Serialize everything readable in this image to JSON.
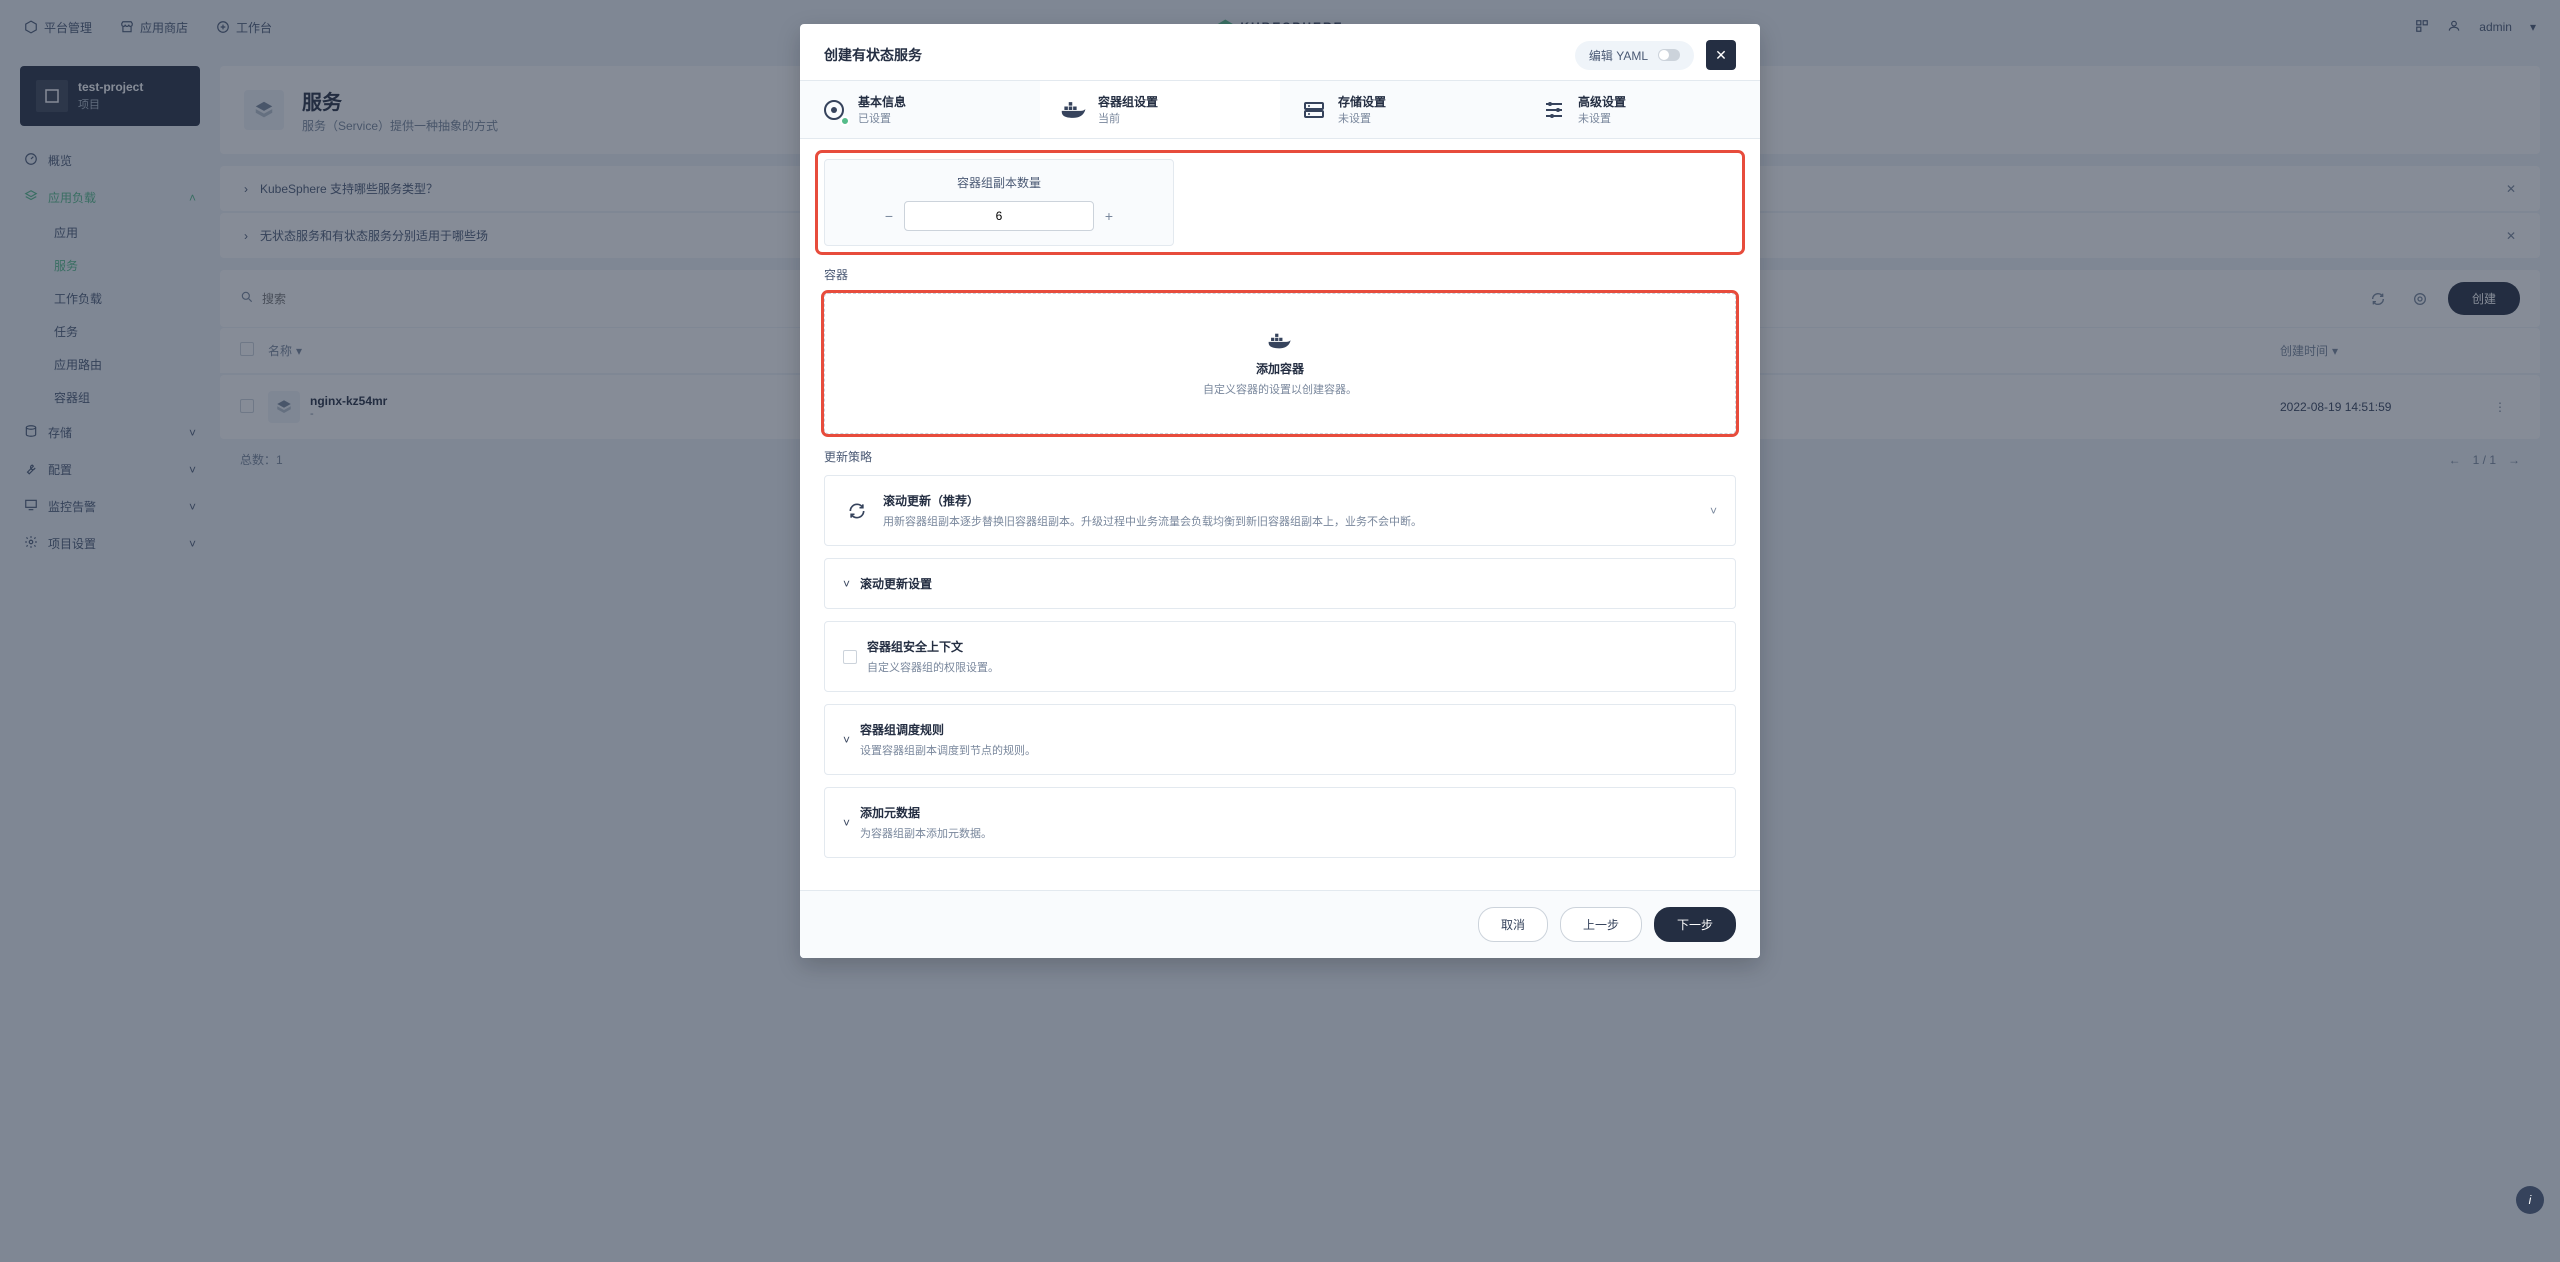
{
  "topbar": {
    "platform_manage": "平台管理",
    "app_store": "应用商店",
    "workbench": "工作台",
    "brand": "KUBESPHERE",
    "user": "admin"
  },
  "project": {
    "name": "test-project",
    "type": "项目"
  },
  "sidebar": {
    "overview": "概览",
    "workload": "应用负载",
    "children": {
      "apps": "应用",
      "services": "服务",
      "workloads": "工作负载",
      "jobs": "任务",
      "routes": "应用路由",
      "pods": "容器组"
    },
    "storage": "存储",
    "config": "配置",
    "monitor": "监控告警",
    "settings": "项目设置"
  },
  "page_header": {
    "title": "服务",
    "desc": "服务（Service）提供一种抽象的方式"
  },
  "faq": {
    "q1": "KubeSphere 支持哪些服务类型？",
    "q2": "无状态服务和有状态服务分别适用于哪些场"
  },
  "toolbar": {
    "search_placeholder": "搜索",
    "create": "创建"
  },
  "table": {
    "columns": {
      "name": "名称",
      "created": "创建时间"
    },
    "rows": [
      {
        "name": "nginx-kz54mr",
        "sub": "-",
        "created": "2022-08-19 14:51:59"
      }
    ],
    "total_label": "总数：1",
    "pager": "1 / 1"
  },
  "modal": {
    "title": "创建有状态服务",
    "yaml_label": "编辑 YAML",
    "steps": {
      "basic": {
        "title": "基本信息",
        "sub": "已设置"
      },
      "pod": {
        "title": "容器组设置",
        "sub": "当前"
      },
      "storage": {
        "title": "存储设置",
        "sub": "未设置"
      },
      "advanced": {
        "title": "高级设置",
        "sub": "未设置"
      }
    },
    "replica": {
      "label": "容器组副本数量",
      "value": "6"
    },
    "container_section_label": "容器",
    "add_container": {
      "title": "添加容器",
      "desc": "自定义容器的设置以创建容器。"
    },
    "update_strategy_label": "更新策略",
    "rolling": {
      "title": "滚动更新（推荐）",
      "desc": "用新容器组副本逐步替换旧容器组副本。升级过程中业务流量会负载均衡到新旧容器组副本上，业务不会中断。"
    },
    "rolling_settings": "滚动更新设置",
    "security_context": {
      "title": "容器组安全上下文",
      "desc": "自定义容器组的权限设置。"
    },
    "scheduling": {
      "title": "容器组调度规则",
      "desc": "设置容器组副本调度到节点的规则。"
    },
    "metadata": {
      "title": "添加元数据",
      "desc": "为容器组副本添加元数据。"
    },
    "footer": {
      "cancel": "取消",
      "prev": "上一步",
      "next": "下一步"
    }
  }
}
